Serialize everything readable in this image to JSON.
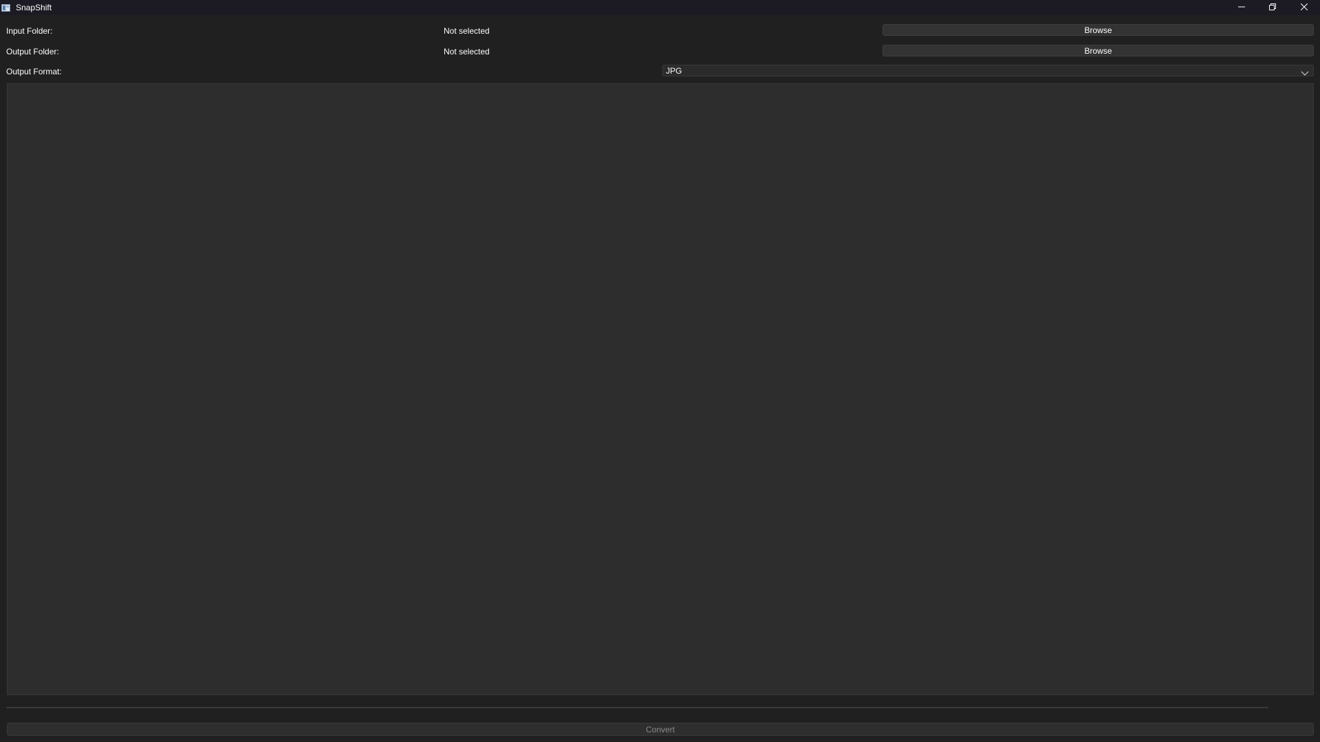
{
  "window": {
    "title": "SnapShift",
    "icon": "app-icon",
    "controls": [
      "minimize-icon",
      "restore-icon",
      "close-icon"
    ]
  },
  "form": {
    "input_folder": {
      "label": "Input Folder:",
      "value": "Not selected",
      "button": "Browse"
    },
    "output_folder": {
      "label": "Output Folder:",
      "value": "Not selected",
      "button": "Browse"
    },
    "output_format": {
      "label": "Output Format:",
      "selected": "JPG"
    }
  },
  "progress": {
    "value": 0
  },
  "actions": {
    "convert_label": "Convert",
    "convert_enabled": false
  },
  "colors": {
    "background": "#202020",
    "titlebar": "#1c1b24",
    "panel": "#2d2d2d",
    "button": "#333333",
    "text": "#ffffff",
    "disabled_text": "#8a8a8a"
  }
}
